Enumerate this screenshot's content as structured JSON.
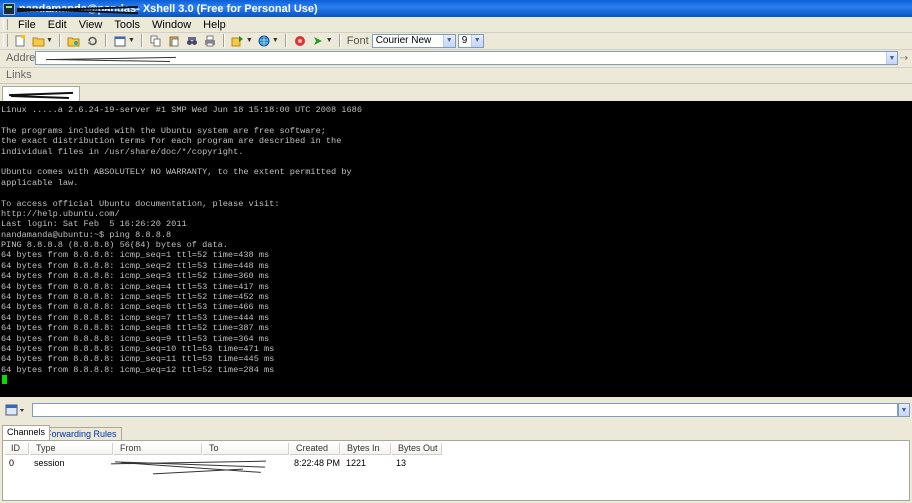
{
  "window": {
    "title_obscured": "nandamanda@pandas",
    "title": " - Xshell 3.0 (Free for Personal Use)"
  },
  "menu": [
    "File",
    "Edit",
    "View",
    "Tools",
    "Window",
    "Help"
  ],
  "toolbar": {
    "font_label": "Font",
    "font_value": "Courier New",
    "size_value": "9"
  },
  "address": {
    "label": "Address"
  },
  "links": {
    "label": "Links"
  },
  "terminal": {
    "lines": [
      "Linux .....a 2.6.24-19-server #1 SMP Wed Jun 18 15:18:00 UTC 2008 i686",
      "",
      "The programs included with the Ubuntu system are free software;",
      "the exact distribution terms for each program are described in the",
      "individual files in /usr/share/doc/*/copyright.",
      "",
      "Ubuntu comes with ABSOLUTELY NO WARRANTY, to the extent permitted by",
      "applicable law.",
      "",
      "To access official Ubuntu documentation, please visit:",
      "http://help.ubuntu.com/",
      "Last login: Sat Feb  5 16:26:20 2011",
      "nandamanda@ubuntu:~$ ping 8.8.8.8",
      "PING 8.8.8.8 (8.8.8.8) 56(84) bytes of data.",
      "64 bytes from 8.8.8.8: icmp_seq=1 ttl=52 time=438 ms",
      "64 bytes from 8.8.8.8: icmp_seq=2 ttl=53 time=448 ms",
      "64 bytes from 8.8.8.8: icmp_seq=3 ttl=52 time=360 ms",
      "64 bytes from 8.8.8.8: icmp_seq=4 ttl=53 time=417 ms",
      "64 bytes from 8.8.8.8: icmp_seq=5 ttl=52 time=452 ms",
      "64 bytes from 8.8.8.8: icmp_seq=6 ttl=53 time=466 ms",
      "64 bytes from 8.8.8.8: icmp_seq=7 ttl=53 time=444 ms",
      "64 bytes from 8.8.8.8: icmp_seq=8 ttl=52 time=387 ms",
      "64 bytes from 8.8.8.8: icmp_seq=9 ttl=53 time=364 ms",
      "64 bytes from 8.8.8.8: icmp_seq=10 ttl=53 time=471 ms",
      "64 bytes from 8.8.8.8: icmp_seq=11 ttl=53 time=445 ms",
      "64 bytes from 8.8.8.8: icmp_seq=12 ttl=52 time=284 ms"
    ]
  },
  "panel": {
    "tabs": [
      "Channels",
      "Forwarding Rules"
    ],
    "columns": [
      "ID",
      "Type",
      "From",
      "To",
      "Created",
      "Bytes In",
      "Bytes Out"
    ],
    "rows": [
      {
        "id": "0",
        "type": "session",
        "created": "8:22:48 PM",
        "bytes_in": "1221",
        "bytes_out": "13"
      }
    ]
  },
  "colors": {
    "terminal_bg": "#000000",
    "terminal_fg": "#c0c0c0",
    "cursor": "#00e000",
    "titlebar": "#0a5fd8"
  }
}
